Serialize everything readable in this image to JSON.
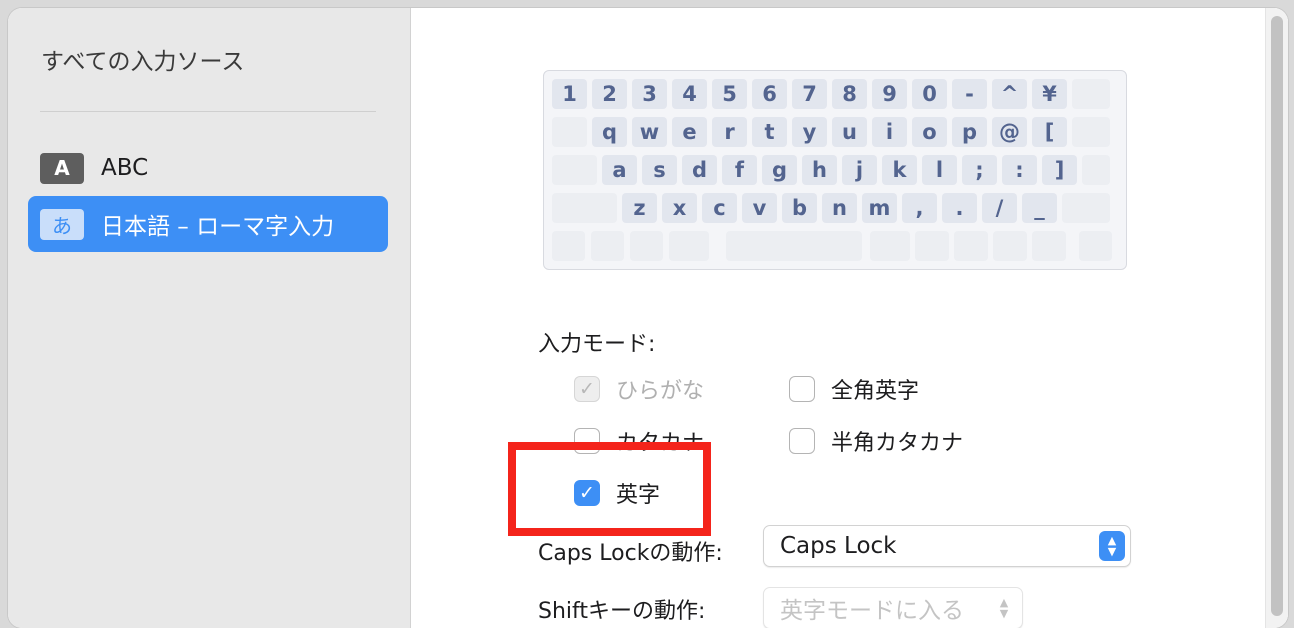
{
  "sidebar": {
    "header": "すべての入力ソース",
    "items": [
      {
        "badge": "A",
        "label": "ABC"
      },
      {
        "badge": "あ",
        "label": "日本語 – ローマ字入力"
      }
    ]
  },
  "keyboard": {
    "rows": [
      [
        "1",
        "2",
        "3",
        "4",
        "5",
        "6",
        "7",
        "8",
        "9",
        "0",
        "-",
        "^",
        "¥"
      ],
      [
        "q",
        "w",
        "e",
        "r",
        "t",
        "y",
        "u",
        "i",
        "o",
        "p",
        "@",
        "["
      ],
      [
        "a",
        "s",
        "d",
        "f",
        "g",
        "h",
        "j",
        "k",
        "l",
        ";",
        ":",
        "]"
      ],
      [
        "z",
        "x",
        "c",
        "v",
        "b",
        "n",
        "m",
        ",",
        ".",
        "/",
        "_"
      ]
    ]
  },
  "input_mode": {
    "title": "入力モード:",
    "hiragana": "ひらがな",
    "zenkaku_eiji": "全角英字",
    "katakana": "カタカナ",
    "hankaku_katakana": "半角カタカナ",
    "eiji": "英字"
  },
  "caps_lock": {
    "label": "Caps Lockの動作:",
    "value": "Caps Lock"
  },
  "shift": {
    "label": "Shiftキーの動作:",
    "value": "英字モードに入る"
  },
  "colors": {
    "accent": "#3d8ff5",
    "highlight": "#f4241b",
    "key_text": "#53648f"
  }
}
